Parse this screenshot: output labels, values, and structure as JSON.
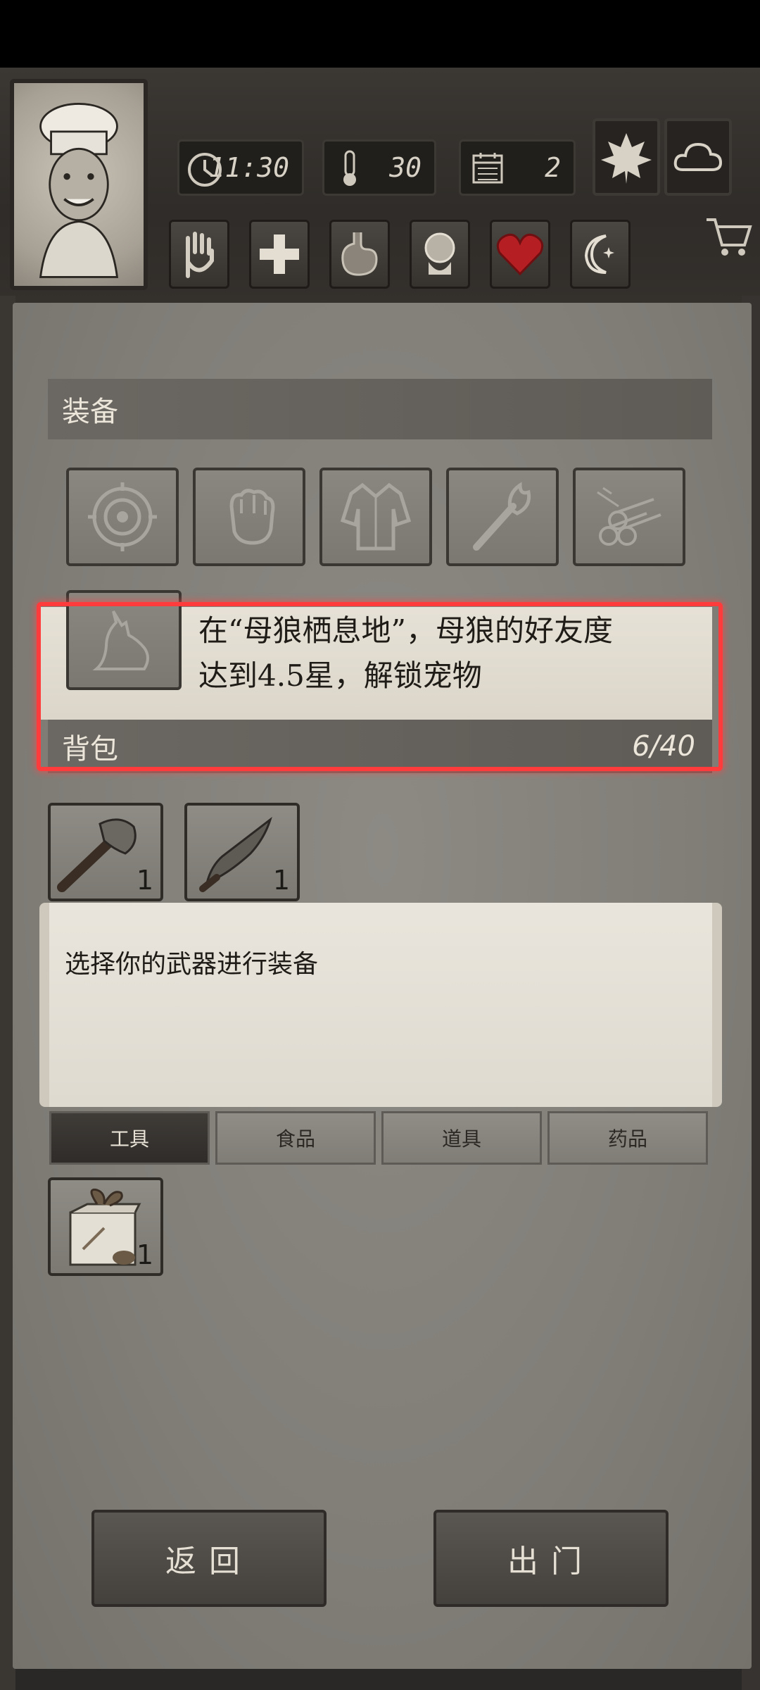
{
  "hud": {
    "time": "11:30",
    "temperature": "30",
    "day": "2"
  },
  "equipment": {
    "title": "装备",
    "slots": [
      "target-icon",
      "fist-icon",
      "jacket-icon",
      "torch-icon",
      "logs-icon"
    ]
  },
  "pet_tooltip": {
    "line1": "在“母狼栖息地”，母狼的好友度",
    "line2": "达到4.5星，解锁宠物"
  },
  "backpack": {
    "title": "背包",
    "count": "6/40",
    "items": [
      {
        "icon": "stone-axe-icon",
        "qty": "1"
      },
      {
        "icon": "stone-knife-icon",
        "qty": "1"
      }
    ]
  },
  "description": "选择你的武器进行装备",
  "tabs": [
    "工具",
    "食品",
    "道具",
    "药品"
  ],
  "tab_items": [
    {
      "icon": "gift-box-icon",
      "qty": "1"
    }
  ],
  "buttons": {
    "back": "返回",
    "go_out": "出门"
  },
  "colors": {
    "highlight": "#ff3b3b",
    "panel": "#817e78",
    "heart": "#b51f23"
  }
}
